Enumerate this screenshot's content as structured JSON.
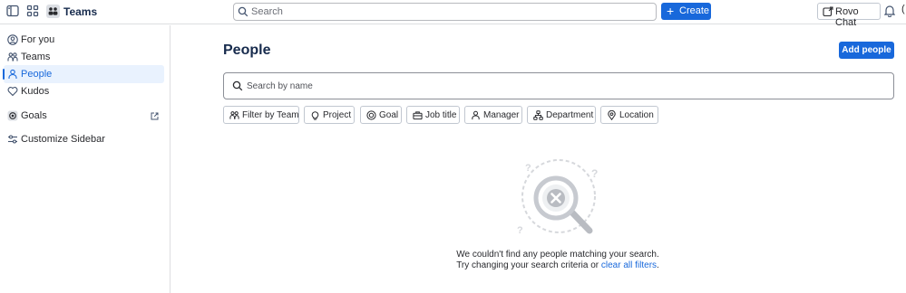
{
  "topbar": {
    "app_name": "Teams",
    "search_placeholder": "Search",
    "create_label": "Create",
    "rovo_label": "Rovo Chat",
    "cutoff_char": "("
  },
  "sidebar": {
    "items": [
      {
        "label": "For you",
        "icon": "user-circle-icon"
      },
      {
        "label": "Teams",
        "icon": "people-icon"
      },
      {
        "label": "People",
        "icon": "person-icon",
        "active": true
      },
      {
        "label": "Kudos",
        "icon": "heart-icon"
      },
      {
        "label": "Goals",
        "icon": "goal-icon"
      },
      {
        "label": "Customize Sidebar",
        "icon": "customize-icon"
      }
    ]
  },
  "main": {
    "title": "People",
    "add_people_label": "Add people",
    "search_placeholder": "Search by name",
    "filters": [
      {
        "label": "Filter by Team",
        "icon": "people-icon"
      },
      {
        "label": "Project",
        "icon": "lightbulb-icon"
      },
      {
        "label": "Goal",
        "icon": "target-icon"
      },
      {
        "label": "Job title",
        "icon": "briefcase-icon"
      },
      {
        "label": "Manager",
        "icon": "person-icon"
      },
      {
        "label": "Department",
        "icon": "hierarchy-icon"
      },
      {
        "label": "Location",
        "icon": "location-pin-icon"
      }
    ],
    "empty": {
      "line1": "We couldn't find any people matching your search.",
      "line2_prefix": "Try changing your search criteria or",
      "line2_link": "clear all filters",
      "line2_suffix": "."
    }
  },
  "colors": {
    "accent": "#1868db",
    "active_bg": "#e9f2fe",
    "border": "#dddee1"
  }
}
